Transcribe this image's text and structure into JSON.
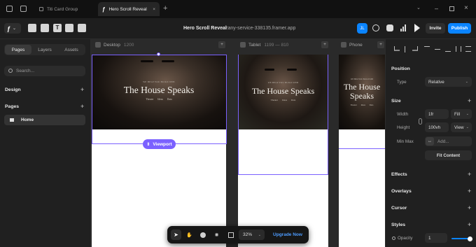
{
  "browser_tabs": [
    {
      "label": "Titi Card Group"
    },
    {
      "label": "Hero Scroll Reveal"
    }
  ],
  "toolbar": {
    "project_title": "Hero Scroll Reveal",
    "site_url": "zany-service-338135.framer.app",
    "avatar_initials": "JL",
    "invite_label": "Invite",
    "publish_label": "Publish"
  },
  "left_panel": {
    "tabs": [
      "Pages",
      "Layers",
      "Assets"
    ],
    "search_placeholder": "Search...",
    "design_label": "Design",
    "pages_label": "Pages",
    "home_label": "Home"
  },
  "canvas": {
    "breakpoints": [
      {
        "name": "Desktop",
        "range": "1200"
      },
      {
        "name": "Tablet",
        "range": "1199 — 810"
      },
      {
        "name": "Phone",
        "range": ""
      }
    ],
    "hero": {
      "kicker": "WE HELP YOU BUILD WEB",
      "title": "The House Speaks",
      "title_phone": "The House Speaks",
      "links": "Theater  Ideas  Data"
    },
    "viewport_badge": "Viewport"
  },
  "bottom_bar": {
    "zoom": "32%",
    "upgrade_label": "Upgrade Now"
  },
  "right_panel": {
    "position_label": "Position",
    "type_label": "Type",
    "type_value": "Relative",
    "size_label": "Size",
    "width_label": "Width",
    "width_value": "1fr",
    "width_mode": "Fill",
    "height_label": "Height",
    "height_value": "100vh",
    "height_mode": "View",
    "minmax_label": "Min Max",
    "add_placeholder": "Add...",
    "fit_content_label": "Fit Content",
    "effects_label": "Effects",
    "overlays_label": "Overlays",
    "cursor_label": "Cursor",
    "styles_label": "Styles",
    "opacity_label": "Opacity",
    "opacity_value": "1",
    "opacity_level": 1.0
  },
  "colors": {
    "accent": "#7b61ff",
    "publish": "#0a84ff"
  }
}
